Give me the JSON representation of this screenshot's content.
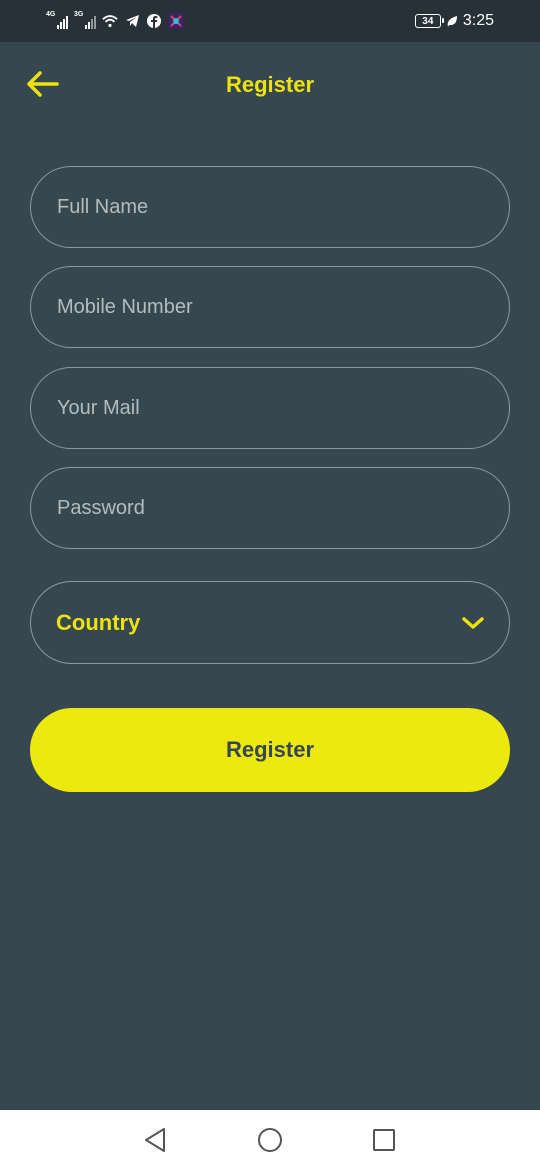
{
  "status_bar": {
    "sim1_type": "4G",
    "sim2_type": "3G",
    "battery_level": "34",
    "time": "3:25",
    "icons": [
      "wifi-icon",
      "telegram-icon",
      "facebook-icon",
      "app-notification-icon",
      "leaf-icon"
    ]
  },
  "app_bar": {
    "title": "Register",
    "back_icon": "arrow-left-icon"
  },
  "form": {
    "full_name": {
      "placeholder": "Full Name",
      "value": ""
    },
    "mobile_number": {
      "placeholder": "Mobile Number",
      "value": ""
    },
    "email": {
      "placeholder": "Your Mail",
      "value": ""
    },
    "password": {
      "placeholder": "Password",
      "value": ""
    },
    "country": {
      "label": "Country",
      "icon": "chevron-down-icon"
    },
    "submit_label": "Register"
  },
  "nav_bar": {
    "buttons": [
      "back-triangle-icon",
      "home-circle-icon",
      "recents-square-icon"
    ]
  },
  "colors": {
    "background": "#37474f",
    "status_bar": "#263238",
    "accent": "#ede90e",
    "field_border": "#8a989f",
    "placeholder": "#b3bcc0"
  }
}
